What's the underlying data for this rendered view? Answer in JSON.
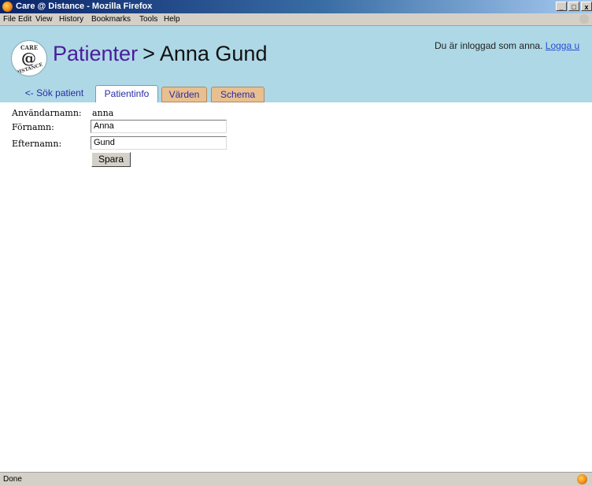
{
  "window": {
    "title": "Care @ Distance - Mozilla Firefox",
    "minimize": "_",
    "maximize": "□",
    "close": "x"
  },
  "menu": [
    "File",
    "Edit",
    "View",
    "History",
    "Bookmarks",
    "Tools",
    "Help"
  ],
  "header": {
    "logo_text": {
      "top": "CARE",
      "middle": "@",
      "bottom": "DISTANCE"
    },
    "breadcrumb": "Patienter",
    "separator": ">",
    "patient_name": "Anna Gund",
    "login_text": "Du är inloggad som anna.",
    "logout_link": "Logga u"
  },
  "tabs": [
    {
      "label": "<- Sök patient",
      "state": "link"
    },
    {
      "label": "Patientinfo",
      "state": "active"
    },
    {
      "label": "Värden",
      "state": "inactive"
    },
    {
      "label": "Schema",
      "state": "inactive"
    }
  ],
  "form": {
    "username_label": "Användarnamn:",
    "username_value": "anna",
    "firstname_label": "Förnamn:",
    "firstname_value": "Anna",
    "lastname_label": "Efternamn:",
    "lastname_value": "Gund",
    "save_button": "Spara"
  },
  "status": {
    "text": "Done"
  }
}
